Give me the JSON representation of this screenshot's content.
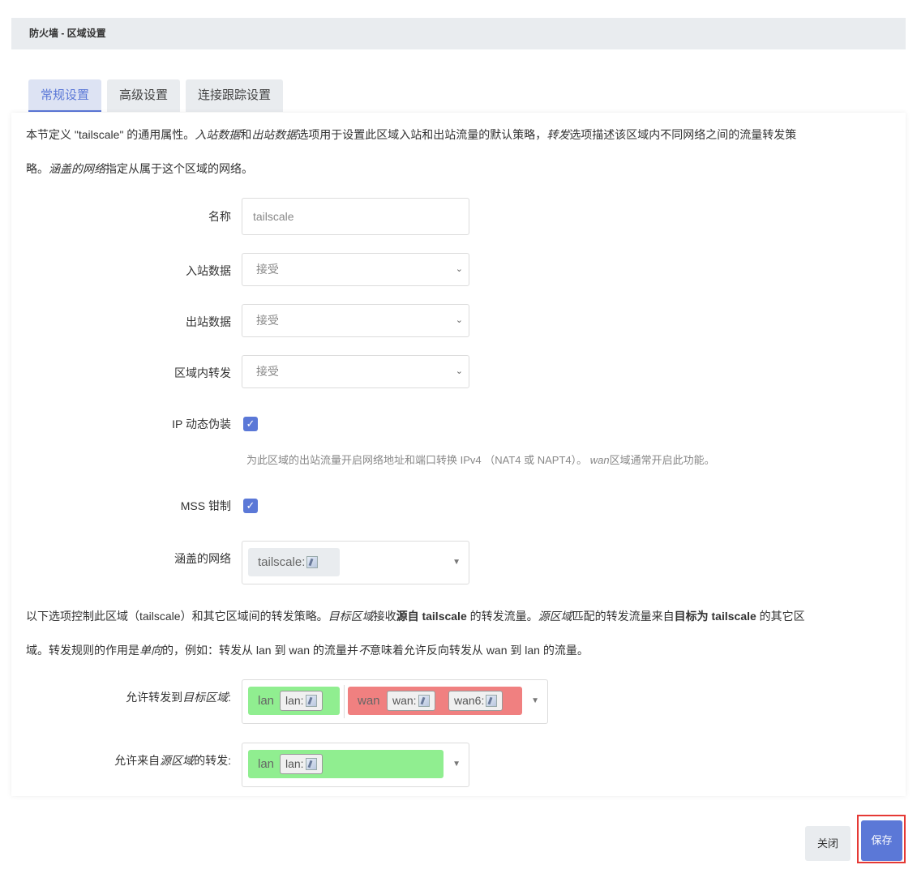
{
  "dialog": {
    "title": "防火墙 - 区域设置"
  },
  "tabs": [
    {
      "label": "常规设置",
      "active": true
    },
    {
      "label": "高级设置",
      "active": false
    },
    {
      "label": "连接跟踪设置",
      "active": false
    }
  ],
  "description_top": {
    "p1": "本节定义 \"tailscale\" 的通用属性。",
    "p2": "入站数据",
    "p3": "和",
    "p4": "出站数据",
    "p5": "选项用于设置此区域入站和出站流量的默认策略，",
    "p6": "转发",
    "p7": "选项描述该区域内不同网络之间的流量转发策",
    "p8": "略。",
    "p9": "涵盖的网络",
    "p10": "指定从属于这个区域的网络。"
  },
  "fields": {
    "name": {
      "label": "名称",
      "value": "tailscale"
    },
    "input": {
      "label": "入站数据",
      "value": "接受"
    },
    "output": {
      "label": "出站数据",
      "value": "接受"
    },
    "forward": {
      "label": "区域内转发",
      "value": "接受"
    },
    "masq": {
      "label": "IP 动态伪装",
      "checked": true,
      "hint_a": "为此区域的出站流量开启网络地址和端口转换 IPv4 （NAT4 或 NAPT4）。",
      "hint_b": "wan",
      "hint_c": "区域通常开启此功能。"
    },
    "mss": {
      "label": "MSS 钳制",
      "checked": true
    },
    "networks": {
      "label": "涵盖的网络",
      "chip": "tailscale:"
    }
  },
  "description_bottom": {
    "p1": "以下选项控制此区域（tailscale）和其它区域间的转发策略。",
    "p2": "目标区域",
    "p3": "接收",
    "p4": "源自 tailscale",
    "p5": " 的转发流量。",
    "p6": "源区域",
    "p7": "匹配的转发流量来自",
    "p8": "目标为 tailscale",
    "p9": " 的其它区",
    "p10": "域。转发规则的作用是",
    "p11": "单向",
    "p12": "的，例如：转发从 lan 到 wan 的流量并",
    "p13": "不",
    "p14": "意味着允许反向转发从 wan 到 lan 的流量。"
  },
  "forwarding": {
    "dest": {
      "label_a": "允许转发到",
      "label_b": "目标区域",
      "label_c": ":",
      "zones": [
        {
          "name": "lan",
          "color": "#90ee90",
          "chips": [
            "lan:"
          ]
        },
        {
          "name": "wan",
          "color": "#f08080",
          "chips": [
            "wan:",
            "wan6:"
          ]
        }
      ]
    },
    "src": {
      "label_a": "允许来自",
      "label_b": "源区域",
      "label_c": "的转发:",
      "zones": [
        {
          "name": "lan",
          "color": "#90ee90",
          "chips": [
            "lan:"
          ]
        }
      ]
    }
  },
  "footer": {
    "close_label": "关闭",
    "save_label": "保存"
  },
  "colors": {
    "accent": "#5b78d7",
    "zone_lan": "#90ee90",
    "zone_wan": "#f08080",
    "highlight": "#e53935"
  }
}
